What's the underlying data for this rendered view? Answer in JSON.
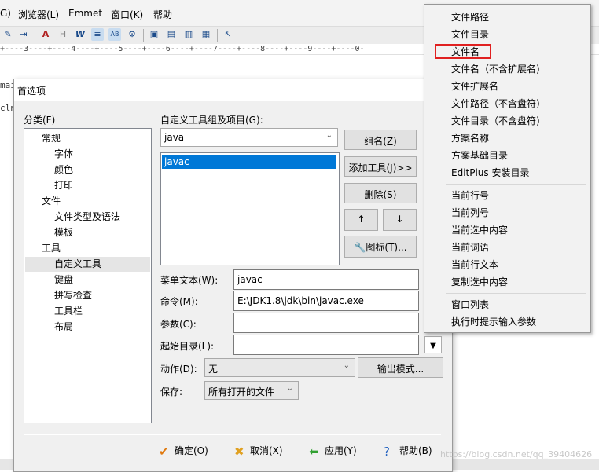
{
  "menubar": {
    "items": [
      "G)",
      "浏览器(L)",
      "Emmet",
      "窗口(K)",
      "帮助"
    ]
  },
  "ruler": "+----3----+----4----+----5----+----6----+----7----+----8----+----9----+----0-",
  "editor": {
    "line1": "mai",
    "line2": "cln"
  },
  "watermark": "https://blog.csdn.net/qq_39404626",
  "dialog": {
    "title": "首选项",
    "category_label": "分类(F)",
    "tree": [
      "常规",
      "字体",
      "颜色",
      "打印",
      "文件",
      "文件类型及语法",
      "模板",
      "工具",
      "自定义工具",
      "键盘",
      "拼写检查",
      "工具栏",
      "布局"
    ],
    "group_label": "自定义工具组及项目(G):",
    "group_value": "java",
    "list_items": [
      "javac"
    ],
    "buttons": {
      "group_name": "组名(Z)",
      "add_tool": "添加工具(J)>>",
      "delete": "删除(S)",
      "up": "↑",
      "down": "↓",
      "icon": "图标(T)..."
    },
    "fields": {
      "menu_text_label": "菜单文本(W):",
      "menu_text_value": "javac",
      "command_label": "命令(M):",
      "command_value": "E:\\JDK1.8\\jdk\\bin\\javac.exe",
      "args_label": "参数(C):",
      "args_value": "",
      "start_dir_label": "起始目录(L):",
      "start_dir_value": "",
      "action_label": "动作(D):",
      "action_value": "无",
      "output_mode": "输出模式...",
      "save_label": "保存:",
      "save_value": "所有打开的文件"
    },
    "footer": {
      "ok": "确定(O)",
      "cancel": "取消(X)",
      "apply": "应用(Y)",
      "help": "帮助(B)"
    }
  },
  "context_menu": {
    "group1": [
      "文件路径",
      "文件目录",
      "文件名",
      "文件名（不含扩展名)",
      "文件扩展名",
      "文件路径（不含盘符)",
      "文件目录（不含盘符)",
      "方案名称",
      "方案基础目录",
      "EditPlus 安装目录"
    ],
    "group2": [
      "当前行号",
      "当前列号",
      "当前选中内容",
      "当前词语",
      "当前行文本",
      "复制选中内容"
    ],
    "group3": [
      "窗口列表",
      "执行时提示输入参数"
    ]
  }
}
